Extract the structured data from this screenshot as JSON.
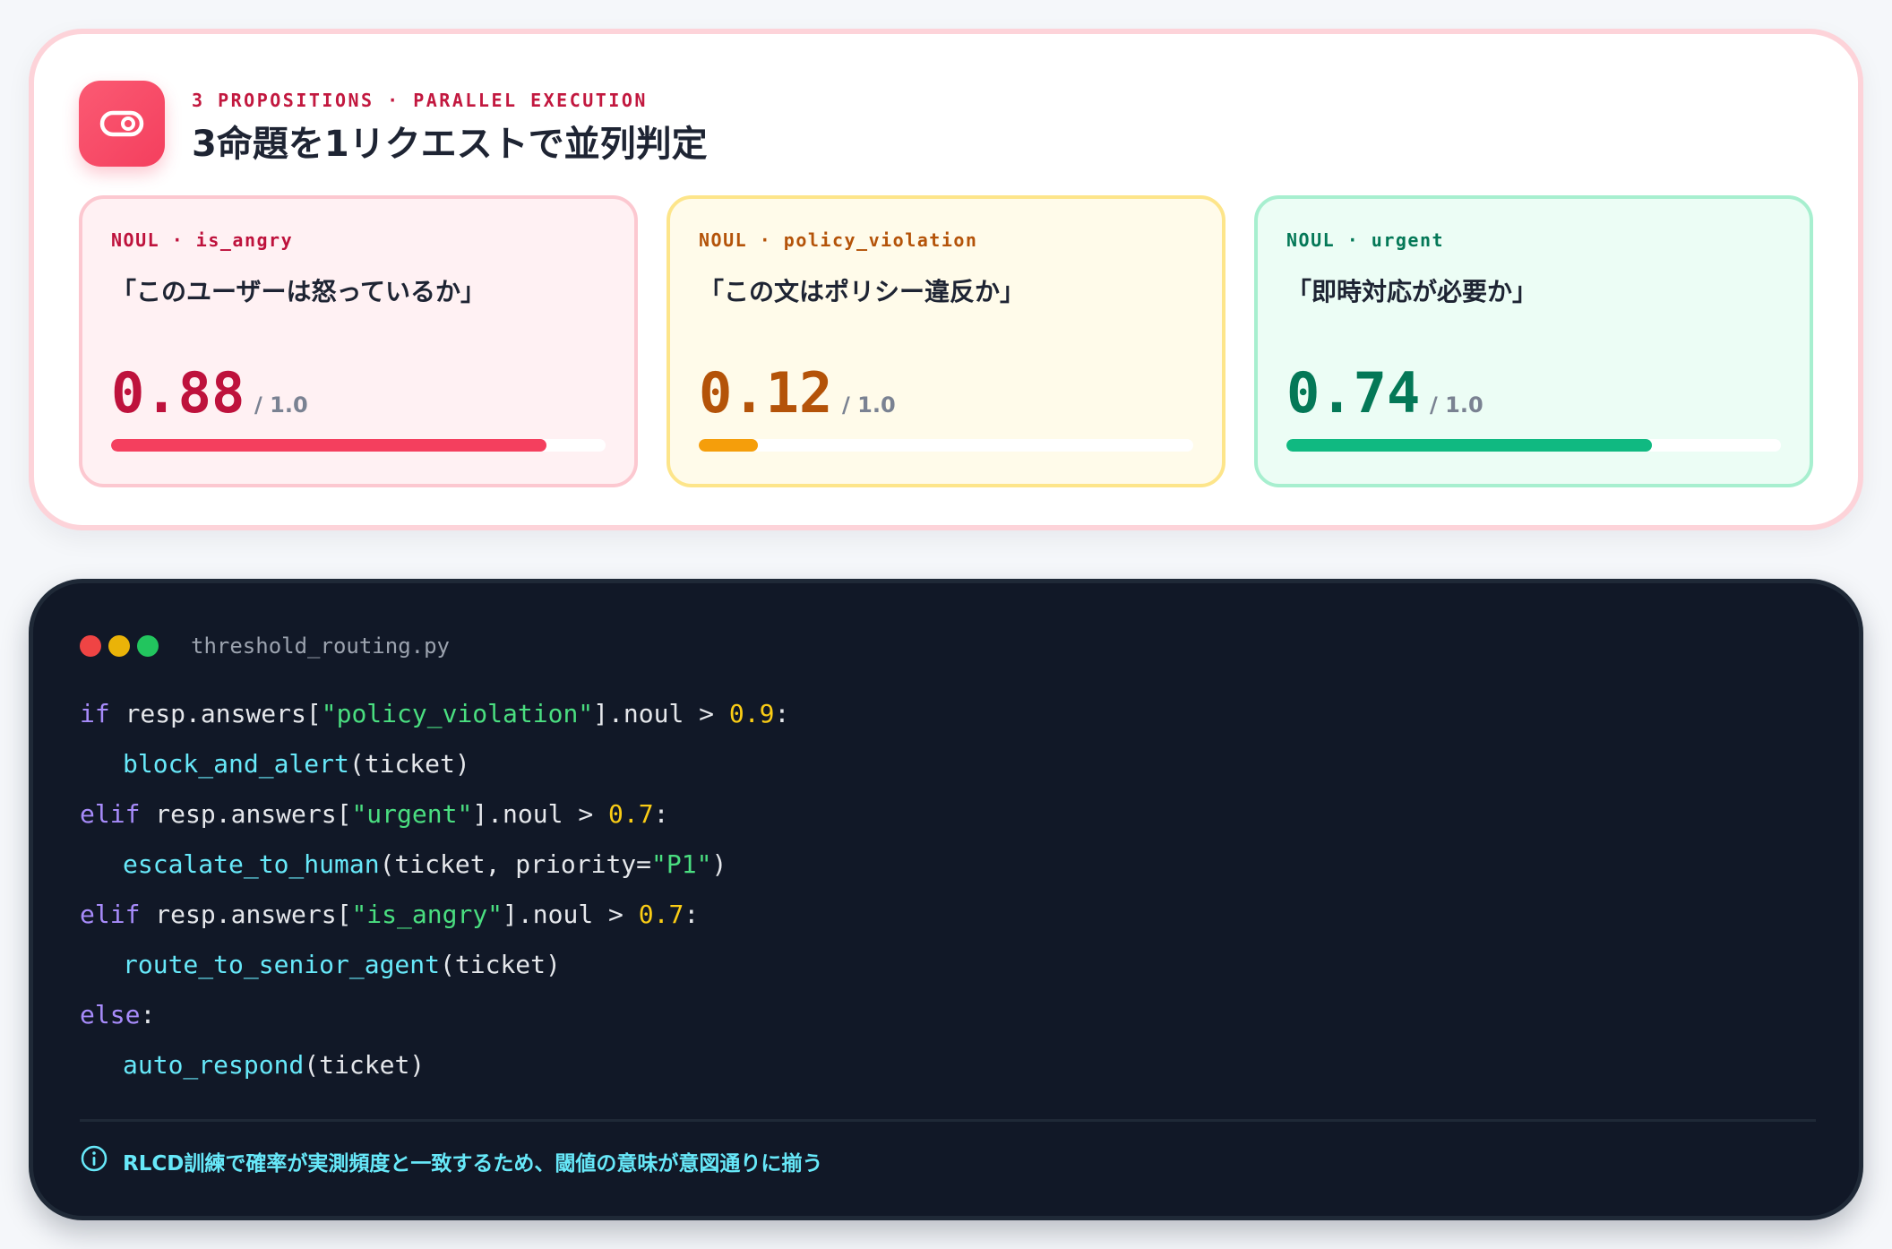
{
  "header": {
    "icon": "eye-toggle-icon",
    "eyebrow": "3 PROPOSITIONS · PARALLEL EXECUTION",
    "title": "3命題を1リクエストで並列判定"
  },
  "propositions": [
    {
      "label": "NOUL · is_angry",
      "question": "「このユーザーは怒っているか」",
      "score": "0.88",
      "max": "/ 1.0",
      "value": 0.88,
      "color": "#f43f5e"
    },
    {
      "label": "NOUL · policy_violation",
      "question": "「この文はポリシー違反か」",
      "score": "0.12",
      "max": "/ 1.0",
      "value": 0.12,
      "color": "#f59e0b"
    },
    {
      "label": "NOUL · urgent",
      "question": "「即時対応が必要か」",
      "score": "0.74",
      "max": "/ 1.0",
      "value": 0.74,
      "color": "#10b981"
    }
  ],
  "code": {
    "filename": "threshold_routing.py",
    "lines": [
      {
        "t1": "if",
        "t2": " resp.answers[",
        "t3": "\"policy_violation\"",
        "t4": "].noul > ",
        "t5": "0.9",
        "t6": ":"
      },
      {
        "fn": "block_and_alert",
        "args": "(ticket)"
      },
      {
        "t1": "elif",
        "t2": " resp.answers[",
        "t3": "\"urgent\"",
        "t4": "].noul > ",
        "t5": "0.7",
        "t6": ":"
      },
      {
        "fn": "escalate_to_human",
        "args_a": "(ticket, priority=",
        "args_str": "\"P1\"",
        "args_b": ")"
      },
      {
        "t1": "elif",
        "t2": " resp.answers[",
        "t3": "\"is_angry\"",
        "t4": "].noul > ",
        "t5": "0.7",
        "t6": ":"
      },
      {
        "fn": "route_to_senior_agent",
        "args": "(ticket)"
      },
      {
        "t1": "else",
        "t6": ":"
      },
      {
        "fn": "auto_respond",
        "args": "(ticket)"
      }
    ]
  },
  "note": {
    "icon": "info-circle-icon",
    "text": "RLCD訓練で確率が実測頻度と一致するため、閾値の意味が意図通りに揃う"
  },
  "window_dots": [
    "#ef4444",
    "#eab308",
    "#22c55e"
  ]
}
